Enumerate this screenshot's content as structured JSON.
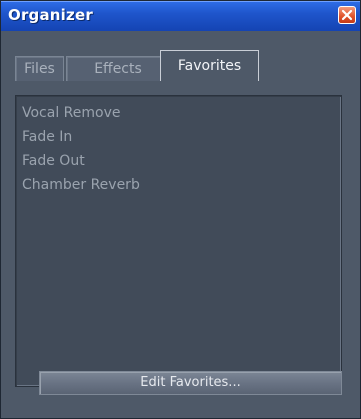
{
  "window": {
    "title": "Organizer",
    "close_icon": "close-icon"
  },
  "tabs": [
    {
      "label": "Files",
      "active": false
    },
    {
      "label": "Effects",
      "active": false
    },
    {
      "label": "Favorites",
      "active": true
    }
  ],
  "favorites": [
    {
      "label": "Vocal Remove"
    },
    {
      "label": "Fade In"
    },
    {
      "label": "Fade Out"
    },
    {
      "label": "Chamber Reverb"
    }
  ],
  "edit_button": {
    "label": "Edit Favorites..."
  },
  "colors": {
    "titlebar": "#1f56cc",
    "close_button": "#e0522b",
    "panel_bg": "#4e5968",
    "list_bg": "#414b59"
  }
}
